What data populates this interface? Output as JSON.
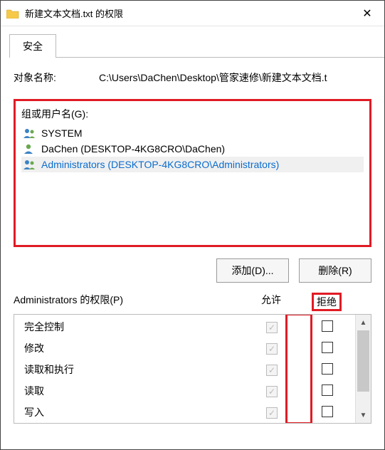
{
  "window": {
    "title": "新建文本文档.txt 的权限",
    "close_glyph": "✕"
  },
  "tab": {
    "security_label": "安全"
  },
  "object": {
    "label": "对象名称:",
    "path": "C:\\Users\\DaChen\\Desktop\\管家速修\\新建文本文档.t"
  },
  "groups": {
    "label": "组或用户名(G):",
    "items": [
      {
        "name": "SYSTEM",
        "icon": "group",
        "selected": false
      },
      {
        "name": "DaChen (DESKTOP-4KG8CRO\\DaChen)",
        "icon": "user",
        "selected": false
      },
      {
        "name": "Administrators (DESKTOP-4KG8CRO\\Administrators)",
        "icon": "group",
        "selected": true
      }
    ]
  },
  "buttons": {
    "add": "添加(D)...",
    "remove": "删除(R)"
  },
  "permissions": {
    "header_label": "Administrators 的权限(P)",
    "allow_label": "允许",
    "deny_label": "拒绝",
    "rows": [
      {
        "name": "完全控制",
        "allow_checked": true,
        "allow_disabled": true,
        "deny_checked": false
      },
      {
        "name": "修改",
        "allow_checked": true,
        "allow_disabled": true,
        "deny_checked": false
      },
      {
        "name": "读取和执行",
        "allow_checked": true,
        "allow_disabled": true,
        "deny_checked": false
      },
      {
        "name": "读取",
        "allow_checked": true,
        "allow_disabled": true,
        "deny_checked": false
      },
      {
        "name": "写入",
        "allow_checked": true,
        "allow_disabled": true,
        "deny_checked": false
      }
    ]
  },
  "icons": {
    "check_glyph": "✓",
    "up_glyph": "▲",
    "down_glyph": "▼"
  }
}
